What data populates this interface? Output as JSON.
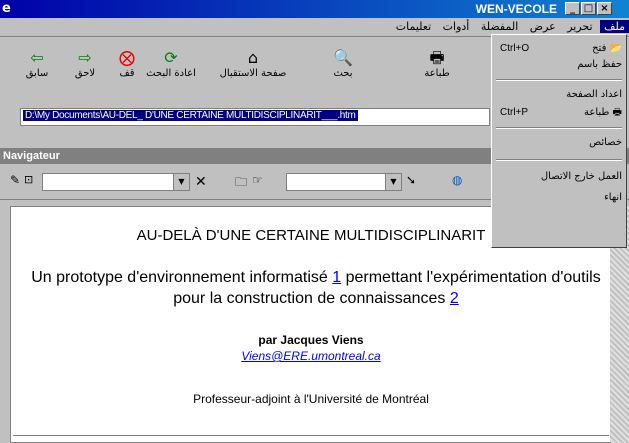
{
  "window": {
    "title": "WEN-VECOLE",
    "icon": "e"
  },
  "menubar": {
    "items": [
      "ملف",
      "تحرير",
      "عرض",
      "المفضلة",
      "أدوات",
      "تعليمات"
    ]
  },
  "toolbar": {
    "back": "سابق",
    "forward": "لاحق",
    "stop": "قف",
    "refresh": "اعادة البحث",
    "home": "صفحة الاستقبال",
    "search": "بحث",
    "print": "طباعة"
  },
  "address": {
    "value": "D:\\My Documents\\AU-DEL_ D'UNE CERTAINE MULTIDISCIPLINARIT___.htm"
  },
  "navigator": {
    "title": "Navigateur"
  },
  "file_menu": {
    "open": "فتح",
    "open_shortcut": "Ctrl+O",
    "save_as": "حفظ باسم",
    "page_setup": "اعداد الصفحة",
    "print": "طباعة",
    "print_shortcut": "Ctrl+P",
    "properties": "خصائص",
    "work_offline": "العمل خارج الاتصال",
    "exit": "انهاء"
  },
  "document": {
    "title": "AU-DELÀ D'UNE CERTAINE MULTIDISCIPLINARIT",
    "subtitle_a": "Un prototype d'environnement informatisé ",
    "ref1": "1",
    "subtitle_b": " permettant l'expérimentation d'outils pour la construction de connaissances ",
    "ref2": "2",
    "author": "par Jacques Viens",
    "email": "Viens@ERE.umontreal.ca",
    "affiliation": "Professeur-adjoint à l'Université de Montréal"
  },
  "colors": {
    "title_bar": "#0000a8",
    "menu_highlight": "#000080",
    "link": "#0000ff"
  }
}
